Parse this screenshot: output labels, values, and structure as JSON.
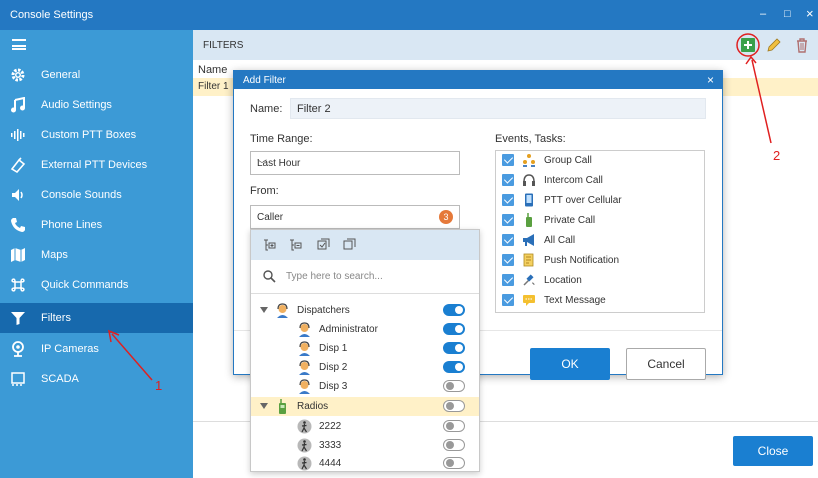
{
  "window": {
    "title": "Console Settings",
    "controls": [
      "–",
      "□",
      "×"
    ]
  },
  "sidebar": {
    "items": [
      {
        "label": "General",
        "icon": "gear-icon"
      },
      {
        "label": "Audio Settings",
        "icon": "music-note-icon"
      },
      {
        "label": "Custom PTT Boxes",
        "icon": "equalizer-icon"
      },
      {
        "label": "External PTT Devices",
        "icon": "device-icon"
      },
      {
        "label": "Console Sounds",
        "icon": "speaker-icon"
      },
      {
        "label": "Phone Lines",
        "icon": "phone-icon"
      },
      {
        "label": "Maps",
        "icon": "map-icon"
      },
      {
        "label": "Quick Commands",
        "icon": "command-icon"
      },
      {
        "label": "Filters",
        "icon": "filter-icon",
        "active": true
      },
      {
        "label": "IP Cameras",
        "icon": "webcam-icon"
      },
      {
        "label": "SCADA",
        "icon": "scada-icon"
      }
    ]
  },
  "main": {
    "header_title": "FILTERS",
    "column_header": "Name",
    "rows": [
      "Filter 1"
    ],
    "close_label": "Close"
  },
  "dialog": {
    "title": "Add Filter",
    "name_label": "Name:",
    "name_value": "Filter 2",
    "time_range_label": "Time Range:",
    "time_range_value": "Last Hour",
    "from_label": "From:",
    "from_value": "Caller",
    "from_count": "3",
    "events_label": "Events, Tasks:",
    "events": [
      {
        "label": "Group Call",
        "icon": "group-call-icon",
        "checked": true
      },
      {
        "label": "Intercom Call",
        "icon": "headset-icon",
        "checked": true
      },
      {
        "label": "PTT over Cellular",
        "icon": "mobile-phone-icon",
        "checked": true
      },
      {
        "label": "Private Call",
        "icon": "radio-icon",
        "checked": true
      },
      {
        "label": "All Call",
        "icon": "megaphone-icon",
        "checked": true
      },
      {
        "label": "Push Notification",
        "icon": "notification-icon",
        "checked": true
      },
      {
        "label": "Location",
        "icon": "satellite-icon",
        "checked": true
      },
      {
        "label": "Text Message",
        "icon": "message-icon",
        "checked": true
      }
    ],
    "ok_label": "OK",
    "cancel_label": "Cancel"
  },
  "dropdown": {
    "search_placeholder": "Type here to search...",
    "tree": [
      {
        "label": "Dispatchers",
        "level": 0,
        "on": true
      },
      {
        "label": "Administrator",
        "level": 1,
        "on": true
      },
      {
        "label": "Disp 1",
        "level": 1,
        "on": true
      },
      {
        "label": "Disp 2",
        "level": 1,
        "on": true
      },
      {
        "label": "Disp 3",
        "level": 1,
        "on": false
      },
      {
        "label": "Radios",
        "level": 0,
        "on": false
      },
      {
        "label": "2222",
        "level": 1,
        "on": false
      },
      {
        "label": "3333",
        "level": 1,
        "on": false
      },
      {
        "label": "4444",
        "level": 1,
        "on": false
      }
    ]
  },
  "annotations": {
    "one": "1",
    "two": "2"
  },
  "colors": {
    "accent": "#2478c2",
    "sidebar": "#3c9ad6",
    "active": "#1769ad",
    "highlight": "#fff1c8",
    "annotation": "#e02020"
  }
}
